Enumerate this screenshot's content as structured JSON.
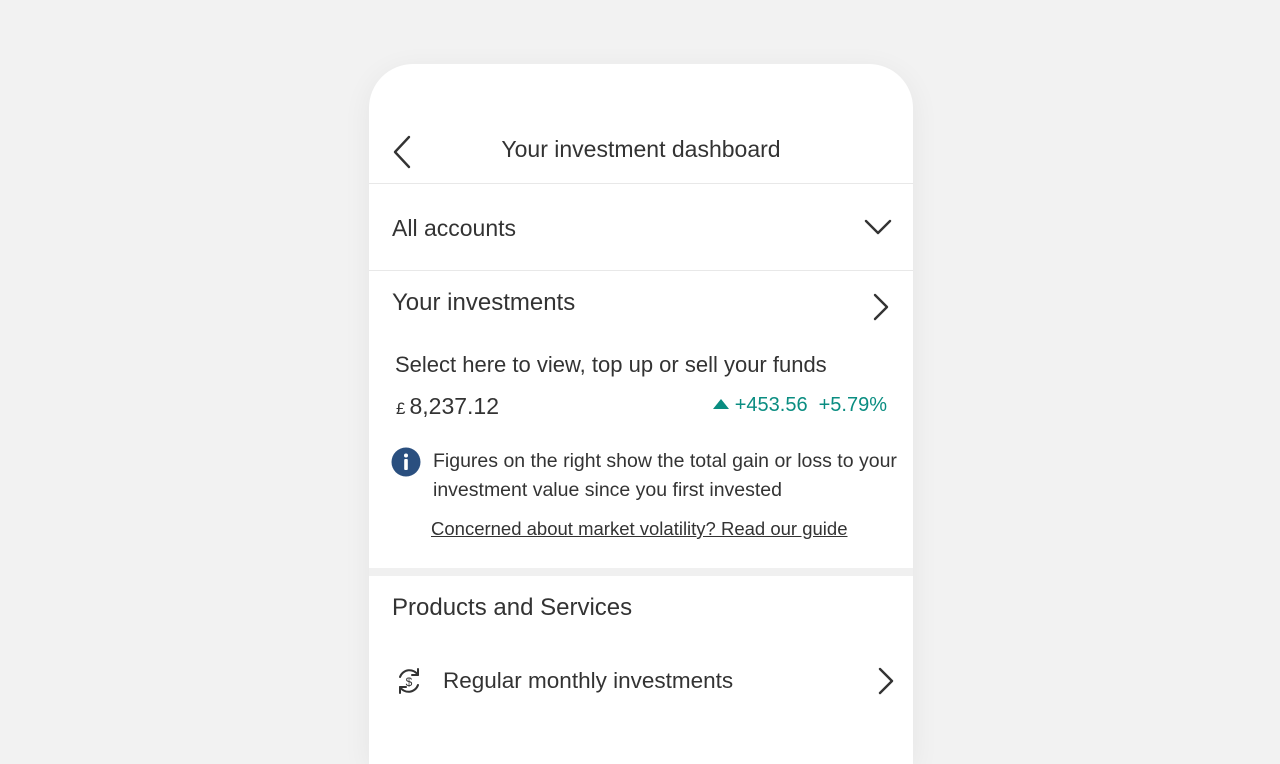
{
  "header": {
    "title": "Your investment dashboard",
    "back_icon": "chevron-left-icon"
  },
  "account_selector": {
    "selected": "All accounts",
    "icon": "chevron-down-icon"
  },
  "investments": {
    "title": "Your investments",
    "description": "Select here to view, top up or sell your funds",
    "currency_symbol": "£",
    "value": "8,237.12",
    "gain": "+453.56",
    "gain_percent": "+5.79%",
    "gain_color": "#0a8d81",
    "info_text": "Figures on the right show the total gain or loss to your investment value since you first invested",
    "info_icon_color": "#2a4f7f",
    "guide_link": "Concerned about market volatility? Read our guide"
  },
  "products": {
    "title": "Products and Services",
    "items": [
      {
        "label": "Regular monthly investments",
        "icon": "recurring-money-icon"
      }
    ]
  }
}
